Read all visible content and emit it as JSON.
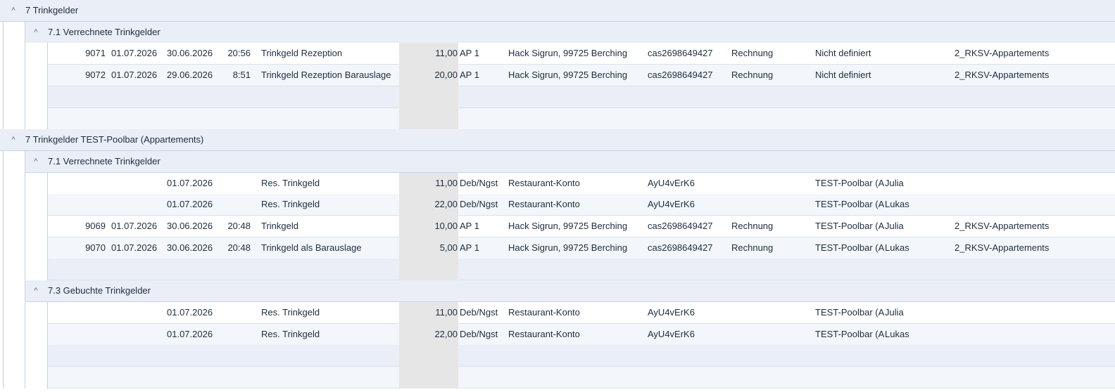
{
  "groups": [
    {
      "label": "7 Trinkgelder",
      "subgroups": [
        {
          "label": "7.1 Verrechnete Trinkgelder",
          "rows": [
            {
              "nr": "9071",
              "datum": "01.07.2026",
              "datum2": "30.06.2026",
              "zeit": "20:56",
              "text": "Trinkgeld Rezeption",
              "betrag": "11,00",
              "kasse": "AP 1",
              "gast": "Hack Sigrun, 99725 Berching",
              "ref": "cas2698649427",
              "typ": "Rechnung",
              "outlet": "Nicht definiert",
              "person": "",
              "betrieb": "2_RKSV-Appartements"
            },
            {
              "nr": "9072",
              "datum": "01.07.2026",
              "datum2": "29.06.2026",
              "zeit": "8:51",
              "text": "Trinkgeld Rezeption Barauslage",
              "betrag": "20,00",
              "kasse": "AP 1",
              "gast": "Hack Sigrun, 99725 Berching",
              "ref": "cas2698649427",
              "typ": "Rechnung",
              "outlet": "Nicht definiert",
              "person": "",
              "betrieb": "2_RKSV-Appartements"
            }
          ]
        }
      ]
    },
    {
      "label": "7 Trinkgelder TEST-Poolbar (Appartements)",
      "subgroups": [
        {
          "label": "7.1 Verrechnete Trinkgelder",
          "rows": [
            {
              "nr": "",
              "datum": "",
              "datum2": "01.07.2026",
              "zeit": "",
              "text": "Res. Trinkgeld",
              "betrag": "11,00",
              "kasse": "Deb/Ngst",
              "gast": "Restaurant-Konto",
              "ref": "AyU4vErK6",
              "typ": "",
              "outlet": "TEST-Poolbar (A|",
              "person": "Julia",
              "betrieb": ""
            },
            {
              "nr": "",
              "datum": "",
              "datum2": "01.07.2026",
              "zeit": "",
              "text": "Res. Trinkgeld",
              "betrag": "22,00",
              "kasse": "Deb/Ngst",
              "gast": "Restaurant-Konto",
              "ref": "AyU4vErK6",
              "typ": "",
              "outlet": "TEST-Poolbar (A|",
              "person": "Lukas",
              "betrieb": ""
            },
            {
              "nr": "9069",
              "datum": "01.07.2026",
              "datum2": "30.06.2026",
              "zeit": "20:48",
              "text": "Trinkgeld",
              "betrag": "10,00",
              "kasse": "AP 1",
              "gast": "Hack Sigrun, 99725 Berching",
              "ref": "cas2698649427",
              "typ": "Rechnung",
              "outlet": "TEST-Poolbar (A|",
              "person": "Julia",
              "betrieb": "2_RKSV-Appartements"
            },
            {
              "nr": "9070",
              "datum": "01.07.2026",
              "datum2": "30.06.2026",
              "zeit": "20:48",
              "text": "Trinkgeld als Barauslage",
              "betrag": "5,00",
              "kasse": "AP 1",
              "gast": "Hack Sigrun, 99725 Berching",
              "ref": "cas2698649427",
              "typ": "Rechnung",
              "outlet": "TEST-Poolbar (A|",
              "person": "Lukas",
              "betrieb": "2_RKSV-Appartements"
            }
          ]
        },
        {
          "label": "7.3 Gebuchte Trinkgelder",
          "rows": [
            {
              "nr": "",
              "datum": "",
              "datum2": "01.07.2026",
              "zeit": "",
              "text": "Res. Trinkgeld",
              "betrag": "11,00",
              "kasse": "Deb/Ngst",
              "gast": "Restaurant-Konto",
              "ref": "AyU4vErK6",
              "typ": "",
              "outlet": "TEST-Poolbar (A|",
              "person": "Julia",
              "betrieb": ""
            },
            {
              "nr": "",
              "datum": "",
              "datum2": "01.07.2026",
              "zeit": "",
              "text": "Res. Trinkgeld",
              "betrag": "22,00",
              "kasse": "Deb/Ngst",
              "gast": "Restaurant-Konto",
              "ref": "AyU4vErK6",
              "typ": "",
              "outlet": "TEST-Poolbar (A|",
              "person": "Lukas",
              "betrieb": ""
            }
          ]
        }
      ]
    }
  ],
  "icons": {
    "collapse": "chevron-up-icon"
  },
  "colors": {
    "header_bg": "#eaeef6",
    "row_alt": "#f3f6fa",
    "band": "#e6e6e6",
    "border": "#c6d3e6"
  }
}
